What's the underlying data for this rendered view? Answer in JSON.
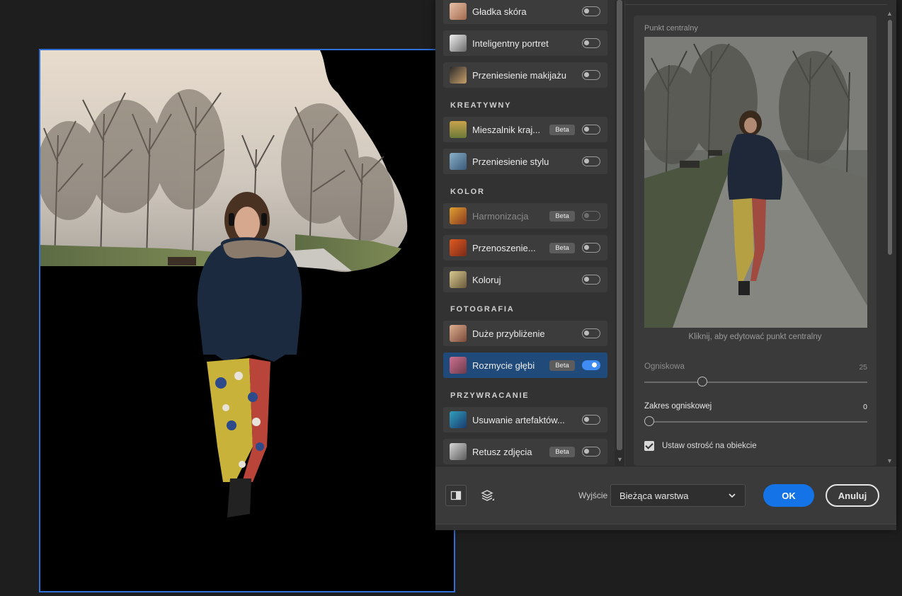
{
  "filters": {
    "top_items": [
      {
        "label": "Gładka skóra",
        "beta": "",
        "on": false,
        "disabled": false
      },
      {
        "label": "Inteligentny portret",
        "beta": "",
        "on": false,
        "disabled": false
      },
      {
        "label": "Przeniesienie makijażu",
        "beta": "",
        "on": false,
        "disabled": false
      }
    ],
    "sections": [
      {
        "title": "KREATYWNY",
        "items": [
          {
            "label": "Mieszalnik kraj...",
            "beta": "Beta",
            "on": false,
            "disabled": false
          },
          {
            "label": "Przeniesienie stylu",
            "beta": "",
            "on": false,
            "disabled": false
          }
        ]
      },
      {
        "title": "KOLOR",
        "items": [
          {
            "label": "Harmonizacja",
            "beta": "Beta",
            "on": false,
            "disabled": true
          },
          {
            "label": "Przenoszenie...",
            "beta": "Beta",
            "on": false,
            "disabled": false
          },
          {
            "label": "Koloruj",
            "beta": "",
            "on": false,
            "disabled": false
          }
        ]
      },
      {
        "title": "FOTOGRAFIA",
        "items": [
          {
            "label": "Duże przybliżenie",
            "beta": "",
            "on": false,
            "disabled": false
          },
          {
            "label": "Rozmycie głębi",
            "beta": "Beta",
            "on": true,
            "disabled": false
          }
        ]
      },
      {
        "title": "PRZYWRACANIE",
        "items": [
          {
            "label": "Usuwanie artefaktów...",
            "beta": "",
            "on": false,
            "disabled": false
          },
          {
            "label": "Retusz zdjęcia",
            "beta": "Beta",
            "on": false,
            "disabled": false
          }
        ]
      }
    ]
  },
  "settings": {
    "focal_point_label": "Punkt centralny",
    "preview_hint": "Kliknij, aby edytować punkt centralny",
    "focal_distance": {
      "label": "Ogniskowa",
      "value": "25",
      "fraction": 0.25
    },
    "focal_range": {
      "label": "Zakres ogniskowej",
      "value": "0",
      "fraction": 0.0
    },
    "focus_subject": {
      "label": "Ustaw ostrość na obiekcie",
      "checked": true
    }
  },
  "footer": {
    "output_label": "Wyjście",
    "output_value": "Bieżąca warstwa",
    "ok_label": "OK",
    "cancel_label": "Anuluj"
  },
  "colors": {
    "accent": "#1473e6",
    "selection_border": "#2f6fd6",
    "active_row": "#1f4a7a"
  },
  "icons": {
    "compare": "split-view-icon",
    "layers": "layers-icon",
    "dropdown": "chevron-down-icon"
  }
}
